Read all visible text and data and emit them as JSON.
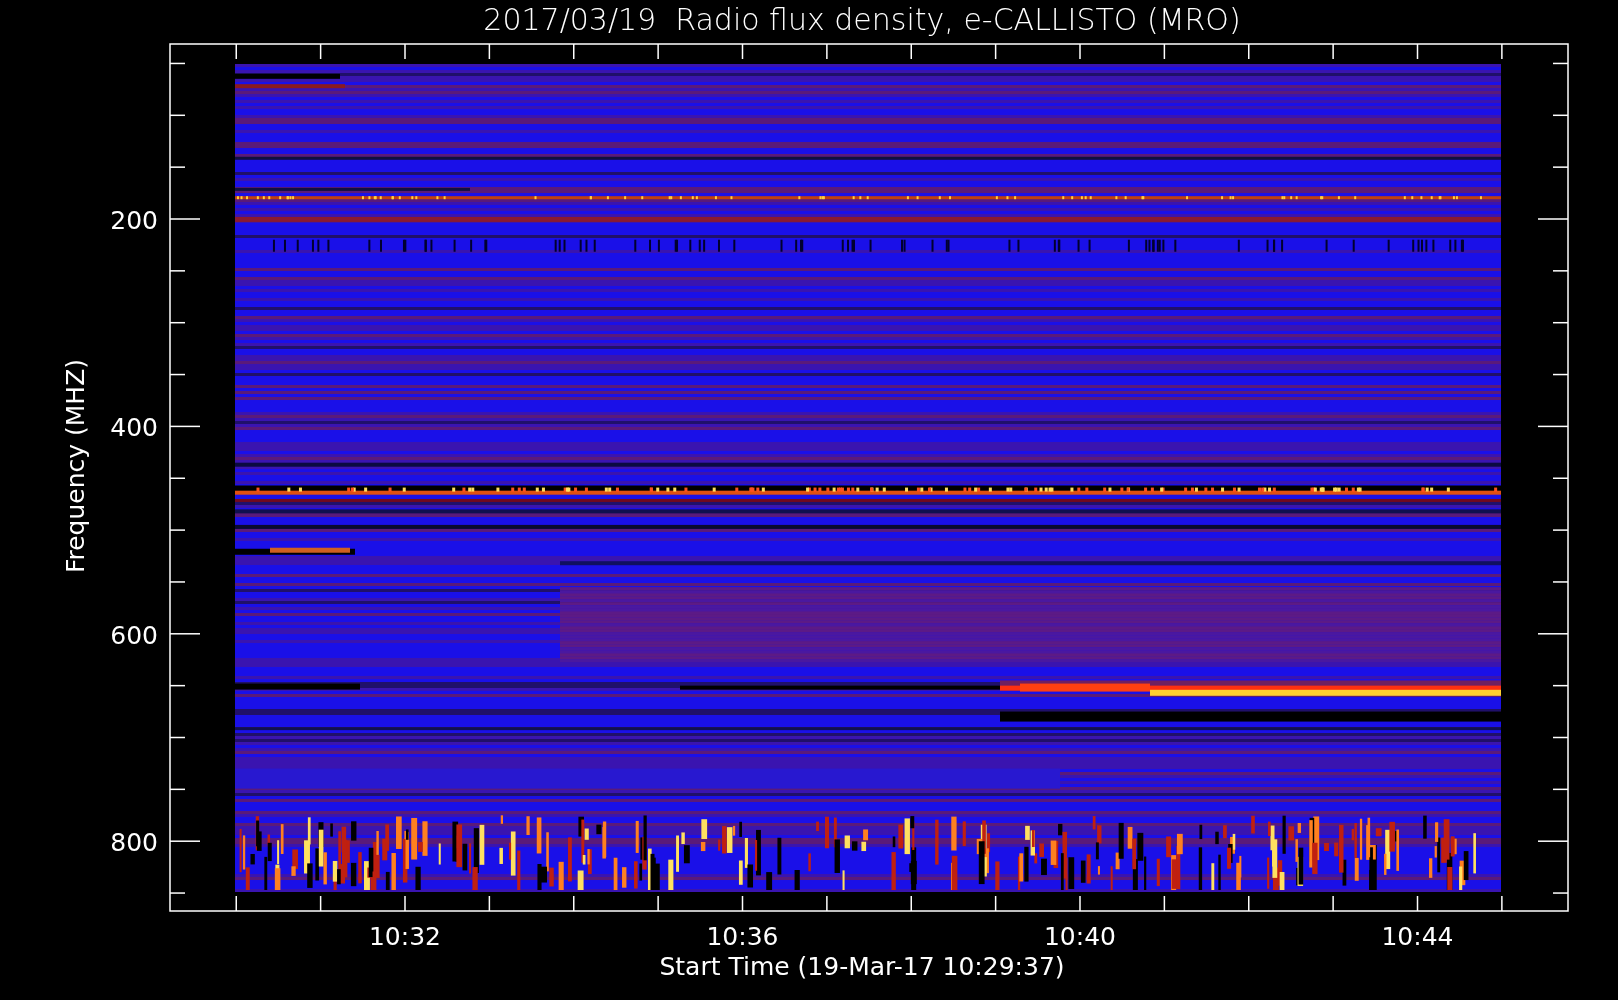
{
  "title": "2017/03/19  Radio flux density, e-CALLISTO (MRO)",
  "y_axis": {
    "label": "Frequency (MHZ)",
    "ticks": [
      "200",
      "400",
      "600",
      "800"
    ]
  },
  "x_axis": {
    "label": "Start Time (19-Mar-17 10:29:37)",
    "ticks": [
      "10:32",
      "10:36",
      "10:40",
      "10:44"
    ]
  }
}
